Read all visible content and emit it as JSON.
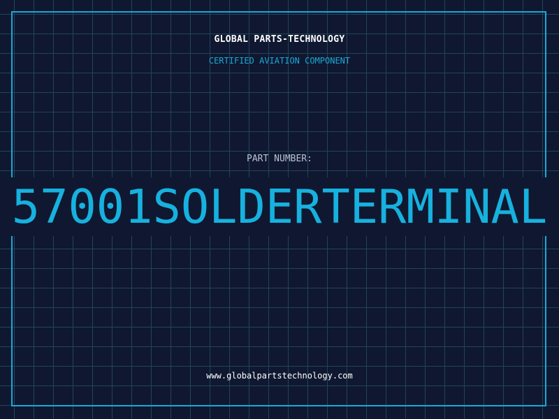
{
  "header": {
    "company": "GLOBAL PARTS-TECHNOLOGY",
    "subtitle": "CERTIFIED AVIATION COMPONENT"
  },
  "part": {
    "label": "PART NUMBER:",
    "number": "57001SOLDERTERMINAL"
  },
  "footer": {
    "website": "www.globalpartstechnology.com"
  },
  "colors": {
    "background": "#0f1830",
    "grid": "#24435a",
    "accent": "#17b1df",
    "text": "#ffffff",
    "muted": "#b8c3d1"
  }
}
